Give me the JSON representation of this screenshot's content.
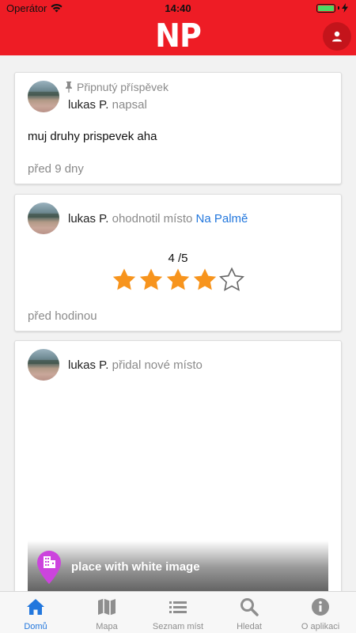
{
  "status_bar": {
    "carrier": "Operátor",
    "time": "14:40",
    "battery_level": 1.0
  },
  "header": {
    "logo": "NP",
    "profile_icon": "person-icon"
  },
  "feed": {
    "cards": [
      {
        "pinned_label": "Připnutý příspěvek",
        "author": "lukas P.",
        "verb": "napsal",
        "text": "muj druhy prispevek aha",
        "time_ago": "před 9 dny"
      },
      {
        "author": "lukas P.",
        "verb": "ohodnotil místo",
        "place": "Na Palmě",
        "rating_text": "4 /5",
        "rating": 4,
        "rating_max": 5,
        "time_ago": "před hodinou"
      },
      {
        "author": "lukas P.",
        "verb": "přidal nové místo",
        "place_name": "place with white image"
      }
    ]
  },
  "tab_bar": {
    "items": [
      {
        "label": "Domů",
        "icon": "home-icon",
        "active": true
      },
      {
        "label": "Mapa",
        "icon": "map-icon",
        "active": false
      },
      {
        "label": "Seznam míst",
        "icon": "list-icon",
        "active": false
      },
      {
        "label": "Hledat",
        "icon": "search-icon",
        "active": false
      },
      {
        "label": "O aplikaci",
        "icon": "info-icon",
        "active": false
      }
    ]
  },
  "colors": {
    "brand_red": "#ee1c25",
    "link_blue": "#2277dd",
    "star_orange": "#f7941d",
    "pin_magenta": "#cc44dd"
  }
}
